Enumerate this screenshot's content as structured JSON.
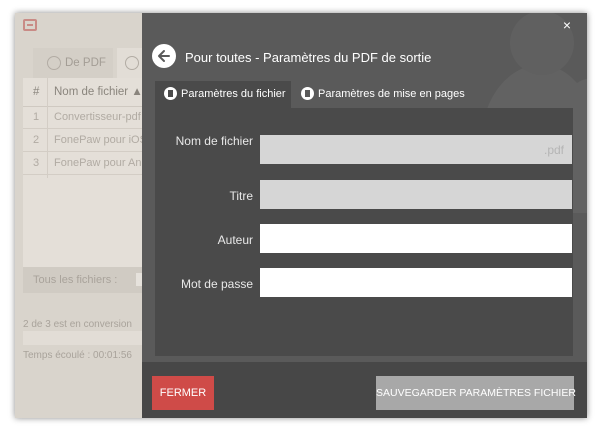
{
  "background": {
    "tabs": [
      "De PDF",
      ""
    ],
    "table": {
      "headers": [
        "#",
        "Nom de fichier"
      ],
      "rows": [
        {
          "num": "1",
          "name": "Convertisseur-pdf"
        },
        {
          "num": "2",
          "name": "FonePaw pour iOS"
        },
        {
          "num": "3",
          "name": "FonePaw pour An"
        }
      ]
    },
    "all_files_label": "Tous les fichiers :",
    "conversion_status": "2 de 3 est en conversion",
    "elapsed": "Temps écoulé : 00:01:56"
  },
  "modal": {
    "close_symbol": "×",
    "title": "Pour toutes - Paramètres du PDF de sortie",
    "tabs": [
      {
        "label": "Paramètres du fichier",
        "icon": "file-settings-icon",
        "active": true
      },
      {
        "label": "Paramètres de mise en pages",
        "icon": "layout-settings-icon",
        "active": false
      }
    ],
    "fields": [
      {
        "label": "Nom de fichier",
        "value": "",
        "placeholder": ".pdf",
        "enabled": false
      },
      {
        "label": "Titre",
        "value": "",
        "placeholder": "",
        "enabled": false
      },
      {
        "label": "Auteur",
        "value": "",
        "placeholder": "",
        "enabled": true
      },
      {
        "label": "Mot de passe",
        "value": "",
        "placeholder": "",
        "enabled": true
      }
    ],
    "buttons": {
      "close": "FERMER",
      "save": "SAUVEGARDER PARAMÈTRES FICHIER"
    }
  },
  "colors": {
    "modal_bg": "#5a5a5a",
    "panel_bg": "#4a4a4a",
    "close_button": "#cf4b48",
    "save_button": "#a8a8a8"
  }
}
